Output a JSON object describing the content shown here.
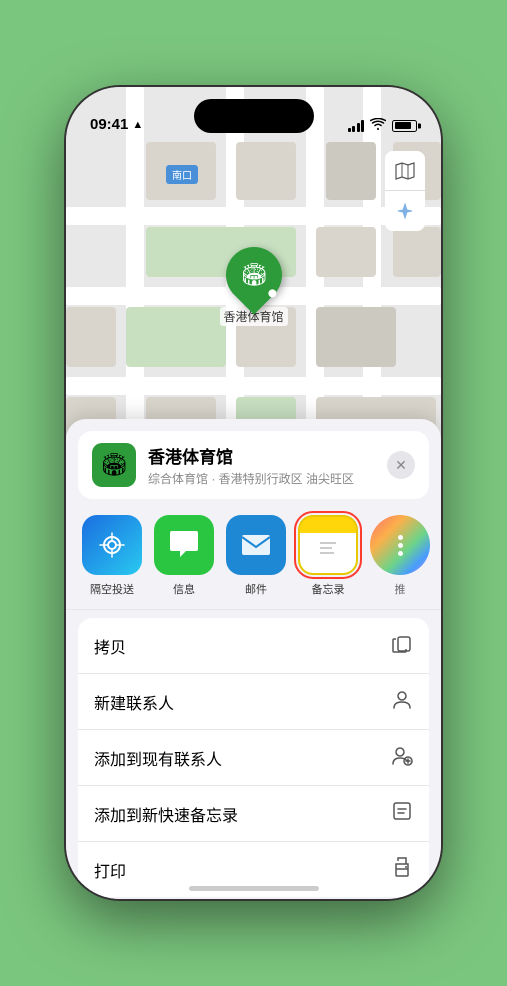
{
  "status": {
    "time": "09:41",
    "location_arrow": "▲"
  },
  "map": {
    "label": "南口",
    "controls": {
      "map_icon": "🗺",
      "location_icon": "➤"
    }
  },
  "pin": {
    "label": "香港体育馆",
    "icon": "🏟"
  },
  "location_card": {
    "name": "香港体育馆",
    "subtitle": "综合体育馆 · 香港特别行政区 油尖旺区",
    "icon": "🏟",
    "close": "✕"
  },
  "share_items": [
    {
      "id": "airdrop",
      "type": "airdrop",
      "label": "隔空投送",
      "icon": "📡"
    },
    {
      "id": "messages",
      "type": "messages",
      "label": "信息",
      "icon": "💬"
    },
    {
      "id": "mail",
      "type": "mail",
      "label": "邮件",
      "icon": "✉"
    },
    {
      "id": "notes",
      "type": "notes",
      "label": "备忘录",
      "icon": "📋",
      "selected": true
    },
    {
      "id": "more",
      "type": "more-apps",
      "label": "推",
      "icon": "•••"
    }
  ],
  "actions": [
    {
      "id": "copy",
      "label": "拷贝",
      "icon": "⊞"
    },
    {
      "id": "new-contact",
      "label": "新建联系人",
      "icon": "👤"
    },
    {
      "id": "add-existing",
      "label": "添加到现有联系人",
      "icon": "👤+"
    },
    {
      "id": "add-notes",
      "label": "添加到新快速备忘录",
      "icon": "⊡"
    },
    {
      "id": "print",
      "label": "打印",
      "icon": "🖨"
    }
  ]
}
